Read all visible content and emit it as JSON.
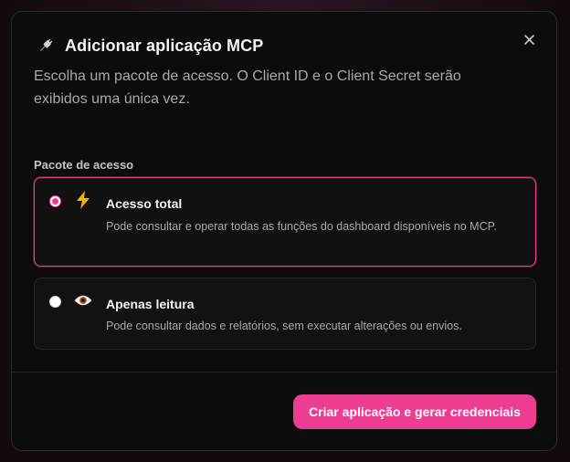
{
  "modal": {
    "title": "Adicionar aplicação MCP",
    "title_icon": "plug-icon",
    "description": "Escolha um pacote de acesso. O Client ID e o Client Secret serão exibidos uma única vez.",
    "close_icon": "close-icon",
    "section_label": "Pacote de acesso",
    "options": [
      {
        "title": "Acesso total",
        "description": "Pode consultar e operar todas as funções do dashboard disponíveis no MCP.",
        "icon": "lightning-icon",
        "selected": true
      },
      {
        "title": "Apenas leitura",
        "description": "Pode consultar dados e relatórios, sem executar alterações ou envios.",
        "icon": "eye-icon",
        "selected": false
      }
    ],
    "primary_button": "Criar aplicação e gerar credenciais"
  },
  "colors": {
    "accent": "#ec3d92",
    "surface": "#0c0c0d",
    "text_primary": "#f4f4f5",
    "text_secondary": "#a8a8ae"
  }
}
